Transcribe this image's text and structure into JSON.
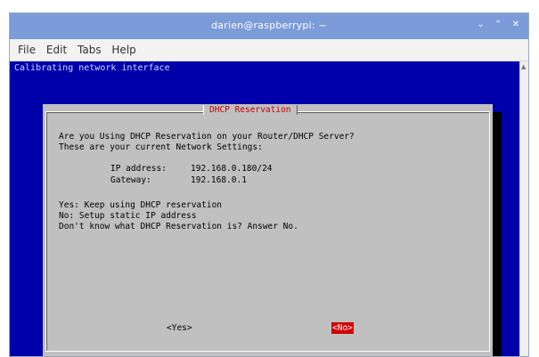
{
  "window": {
    "title": "darien@raspberrypi: ~",
    "controls": [
      "⌄",
      "⌃",
      "✕"
    ]
  },
  "menu": [
    "File",
    "Edit",
    "Tabs",
    "Help"
  ],
  "terminal": {
    "status_line": "Calibrating network interface"
  },
  "dialog": {
    "title": "DHCP Reservation",
    "question_line1": "Are you Using DHCP Reservation on your Router/DHCP Server?",
    "question_line2": "These are your current Network Settings:",
    "ip_label": "IP address:",
    "ip_value": "192.168.0.180/24",
    "gateway_label": "Gateway:",
    "gateway_value": "192.168.0.1",
    "yes_help": "Yes: Keep using DHCP reservation",
    "no_help": "No: Setup static IP address",
    "dont_know": "Don't know what DHCP Reservation is? Answer No.",
    "yes_button": "<Yes>",
    "no_button": "<No>"
  },
  "colors": {
    "titlebar": "#7c9bd9",
    "terminal_bg": "#0000aa",
    "dialog_bg": "#c0c0c0",
    "dialog_title": "#c00000",
    "selected_button_bg": "#d10000"
  }
}
